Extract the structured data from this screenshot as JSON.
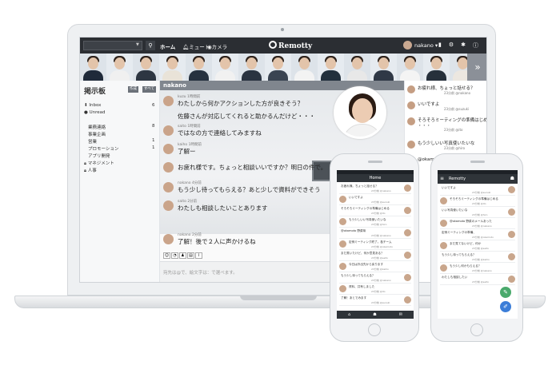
{
  "app": {
    "logo_text": "Remotty",
    "colors": {
      "topbar": "#2b2e33",
      "accent": "#4aa96c",
      "phone_fab_blue": "#3b7dd8"
    }
  },
  "topbar": {
    "home_label": "ホーム",
    "mute_label": "ミュート",
    "camera_label": "カメラ",
    "username": "nakano",
    "icons": [
      "book-icon",
      "gear-icon",
      "settings-icon",
      "info-icon"
    ]
  },
  "sidebar": {
    "title": "掲示板",
    "create_label": "作成",
    "all_label": "すべて",
    "items": [
      {
        "label": "Inbox",
        "count": "6"
      },
      {
        "label": "Unread",
        "count": ""
      },
      {
        "label": "業務連絡",
        "count": "8"
      },
      {
        "label": "事業企画",
        "count": ""
      },
      {
        "label": "営業",
        "count": "1"
      },
      {
        "label": "プロモーション",
        "count": "1"
      },
      {
        "label": "アプリ開発",
        "count": ""
      },
      {
        "label": "マネジメント",
        "count": ""
      },
      {
        "label": "人事",
        "count": ""
      }
    ]
  },
  "chat": {
    "room_name": "nakano",
    "input_placeholder": "宛先は@で、絵文字は：で選べます。",
    "toolbar_icons": [
      "emoji-icon",
      "smile-icon",
      "user-icon",
      "file-icon",
      "attach-icon"
    ],
    "messages": [
      {
        "user": "kuzu",
        "time": "1時間前",
        "text": "わたしから何かアクションした方が良きそう？"
      },
      {
        "user": "",
        "time": "",
        "text": "佐藤さんが対応してくれると助かるんだけど・・・"
      },
      {
        "user": "saito",
        "time": "1時間前",
        "text": "ではなの方で連絡してみますね"
      },
      {
        "user": "kaiho",
        "time": "1時間前",
        "text": "了解ー"
      },
      {
        "user": "",
        "time": "",
        "text": "お疲れ様です。ちょっと相談いいですか？明日の件で。"
      },
      {
        "user": "nakano",
        "time": "4分前",
        "text": "もう少し待ってもらえる？あと少しで資料ができそう"
      },
      {
        "user": "saito",
        "time": "2分前",
        "text": "わたしも相談したいことあります"
      },
      {
        "user": "nakano",
        "time": "2分前",
        "text": "了解！後で２人に声かけるね"
      }
    ]
  },
  "activity": [
    {
      "text": "お疲れ様、ちょっと話せる？",
      "time": "23分前 @nakano"
    },
    {
      "text": "いいですよ",
      "time": "23分前 @suzuki"
    },
    {
      "text": "そろそろミーティングの準備はじめる",
      "time": "23分前 @ito"
    },
    {
      "text": "・・・",
      "time": ""
    },
    {
      "text": "もう少しいい写真使いたいな",
      "time": "23分前 @hiro"
    },
    {
      "text": "@okamoto 野菜味",
      "time": "23分前 @nakano"
    }
  ],
  "phone_left": {
    "title": "Home",
    "rows": [
      {
        "text": "お疲れ様。ちょっと話せる？",
        "time": "23分前 @nakano"
      },
      {
        "text": "いいですよ",
        "time": "23分前 @suzuki"
      },
      {
        "text": "そろそろミーティングの準備はじめる",
        "time": "23分前 @ito"
      },
      {
        "text": "もう少しいい写真使いたいな",
        "time": "23分前 @hiro"
      },
      {
        "text": "@okamoto 野菜味",
        "time": "23分前 @nakano"
      },
      {
        "text": "定例ミーティング終了。各チーム",
        "time": "23分前 @okamoto"
      },
      {
        "text": "まだ書いたけど、何か意見ある？",
        "time": "23分前 @saito"
      },
      {
        "text": "今日は外出先から戻ります",
        "time": "23分前 @kaiho"
      },
      {
        "text": "もう少し待ってもらえる？",
        "time": "23分前 @nakano"
      },
      {
        "text": "資料、共有しました",
        "time": "23分前 @ito"
      },
      {
        "text": "了解！あとでみます",
        "time": "23分前 @suzuki"
      }
    ]
  },
  "phone_right": {
    "title": "Remotty",
    "rows": [
      {
        "text": "いいですよ",
        "time": "23分前 @suzuki"
      },
      {
        "text": "そろそろミーティングの準備はじめる",
        "time": "23分前 @ito"
      },
      {
        "text": "いい写真使いたいな",
        "time": "23分前 @hiro"
      },
      {
        "text": "@okamoto 野菜のメールあった",
        "time": "23分前 @nakano"
      },
      {
        "text": "定例ミーティングの準備、",
        "time": "23分前 @okamoto"
      },
      {
        "text": "まだ見てないけど、何か",
        "time": "23分前 @saito"
      },
      {
        "text": "もう少し待ってもらえる？",
        "time": "23分前 @kaiho"
      },
      {
        "text": "もう少し何かもらえる？",
        "time": "23分前 @nakano"
      },
      {
        "text": "わたしも相談したい",
        "time": "23分前 @saito"
      }
    ]
  }
}
